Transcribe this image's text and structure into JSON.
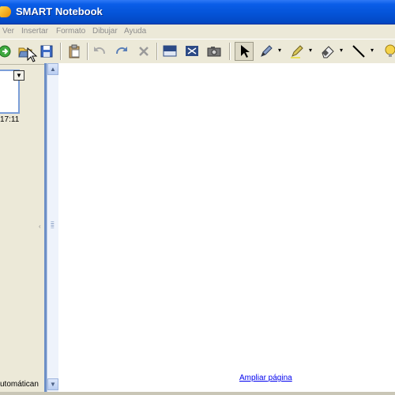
{
  "window": {
    "title": "SMART Notebook"
  },
  "menu": [
    "Ver",
    "Insertar",
    "Formato",
    "Dibujar",
    "Ayuda"
  ],
  "toolbar": {
    "buttons": [
      "next-page",
      "open",
      "save",
      "paste",
      "undo",
      "redo",
      "delete",
      "screen-shade",
      "full-screen",
      "screen-capture",
      "select",
      "pen",
      "highlighter",
      "eraser",
      "line",
      "magic-pen"
    ]
  },
  "left_panel": {
    "thumbnail_time": "17:11",
    "thumbnail_dropdown_glyph": "▼",
    "status_text": "utomátican"
  },
  "canvas": {
    "zoom_link": "Ampliar página"
  },
  "colors": {
    "title_bar": "#0453d6",
    "splitter": "#6d8fc6",
    "link": "#0000ee"
  }
}
